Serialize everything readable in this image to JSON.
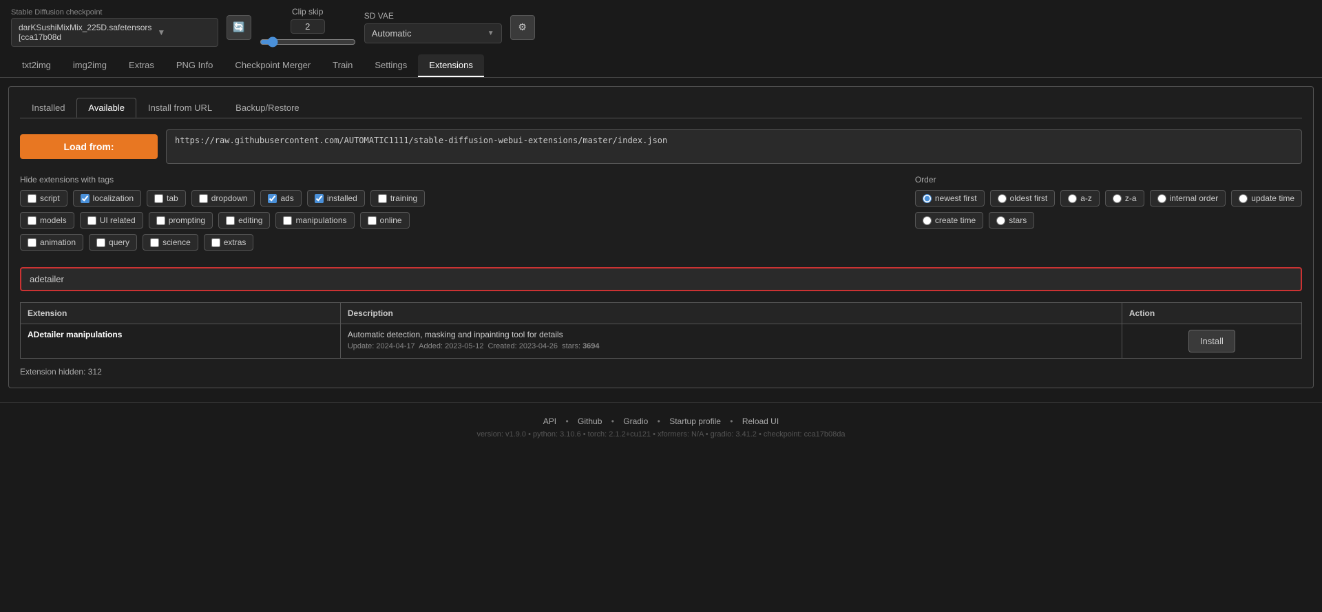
{
  "app": {
    "title": "Stable Diffusion checkpoint"
  },
  "checkpoint": {
    "value": "darKSushiMixMix_225D.safetensors [cca17b08d",
    "btn_icon": "🔄"
  },
  "clip_skip": {
    "label": "Clip skip",
    "value": "2"
  },
  "sd_vae": {
    "label": "SD VAE",
    "value": "Automatic"
  },
  "main_tabs": [
    {
      "id": "txt2img",
      "label": "txt2img",
      "active": false
    },
    {
      "id": "img2img",
      "label": "img2img",
      "active": false
    },
    {
      "id": "extras",
      "label": "Extras",
      "active": false
    },
    {
      "id": "png-info",
      "label": "PNG Info",
      "active": false
    },
    {
      "id": "checkpoint-merger",
      "label": "Checkpoint Merger",
      "active": false
    },
    {
      "id": "train",
      "label": "Train",
      "active": false
    },
    {
      "id": "settings",
      "label": "Settings",
      "active": false
    },
    {
      "id": "extensions",
      "label": "Extensions",
      "active": true
    }
  ],
  "sub_tabs": [
    {
      "id": "installed",
      "label": "Installed",
      "active": false
    },
    {
      "id": "available",
      "label": "Available",
      "active": true
    },
    {
      "id": "install-from-url",
      "label": "Install from URL",
      "active": false
    },
    {
      "id": "backup-restore",
      "label": "Backup/Restore",
      "active": false
    }
  ],
  "load_from": {
    "btn_label": "Load from:",
    "url": "https://raw.githubusercontent.com/AUTOMATIC1111/stable-diffusion-webui-extensions/master/index.json"
  },
  "hide_tags_label": "Hide extensions with tags",
  "checkboxes": [
    {
      "id": "script",
      "label": "script",
      "checked": false
    },
    {
      "id": "localization",
      "label": "localization",
      "checked": true
    },
    {
      "id": "tab",
      "label": "tab",
      "checked": false
    },
    {
      "id": "dropdown",
      "label": "dropdown",
      "checked": false
    },
    {
      "id": "ads",
      "label": "ads",
      "checked": true
    },
    {
      "id": "installed",
      "label": "installed",
      "checked": true
    },
    {
      "id": "training",
      "label": "training",
      "checked": false
    },
    {
      "id": "models",
      "label": "models",
      "checked": false
    },
    {
      "id": "ui-related",
      "label": "UI related",
      "checked": false
    },
    {
      "id": "prompting",
      "label": "prompting",
      "checked": false
    },
    {
      "id": "editing",
      "label": "editing",
      "checked": false
    },
    {
      "id": "manipulations",
      "label": "manipulations",
      "checked": false
    },
    {
      "id": "online",
      "label": "online",
      "checked": false
    },
    {
      "id": "animation",
      "label": "animation",
      "checked": false
    },
    {
      "id": "query",
      "label": "query",
      "checked": false
    },
    {
      "id": "science",
      "label": "science",
      "checked": false
    },
    {
      "id": "extras",
      "label": "extras",
      "checked": false
    }
  ],
  "order_label": "Order",
  "radio_options": [
    {
      "id": "newest-first",
      "label": "newest first",
      "checked": true
    },
    {
      "id": "oldest-first",
      "label": "oldest first",
      "checked": false
    },
    {
      "id": "a-z",
      "label": "a-z",
      "checked": false
    },
    {
      "id": "z-a",
      "label": "z-a",
      "checked": false
    },
    {
      "id": "internal-order",
      "label": "internal order",
      "checked": false
    },
    {
      "id": "update-time",
      "label": "update time",
      "checked": false
    },
    {
      "id": "create-time",
      "label": "create time",
      "checked": false
    },
    {
      "id": "stars",
      "label": "stars",
      "checked": false
    }
  ],
  "search_placeholder": "adetailer",
  "table": {
    "headers": [
      "Extension",
      "Description",
      "Action"
    ],
    "rows": [
      {
        "name": "ADetailer manipulations",
        "description": "Automatic detection, masking and inpainting tool for details",
        "meta": "Update: 2024-04-17  Added: 2023-05-12  Created: 2023-04-26  stars: 3694",
        "action": "Install"
      }
    ]
  },
  "hidden_count_label": "Extension hidden: 312",
  "footer": {
    "links": [
      "API",
      "Github",
      "Gradio",
      "Startup profile",
      "Reload UI"
    ],
    "version_info": "version: v1.9.0  •  python: 3.10.6  •  torch: 2.1.2+cu121  •  xformers: N/A  •  gradio: 3.41.2  •  checkpoint: cca17b08da"
  }
}
